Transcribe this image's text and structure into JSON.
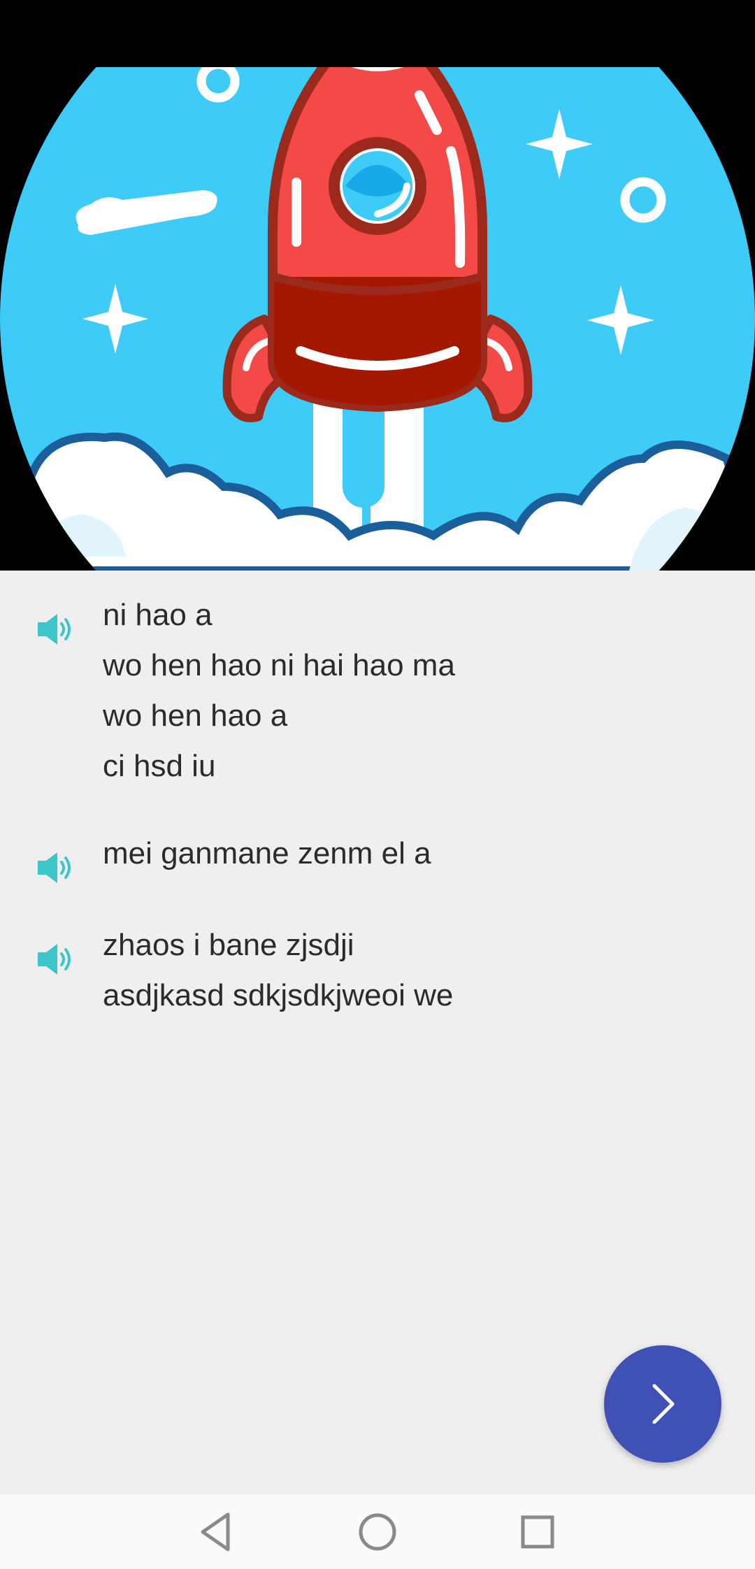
{
  "hero": {
    "image_name": "rocket-illustration",
    "colors": {
      "sky": "#3ecbf7",
      "rocket": "#f44a47",
      "rocket_dark": "#a51800",
      "outline": "#9b2a1c",
      "cloud": "#ffffff",
      "cloud_outline": "#1b5e9c"
    }
  },
  "phrases": [
    {
      "icon": "speaker-icon",
      "lines": [
        "ni hao a",
        "wo hen hao ni hai hao ma",
        "wo hen hao a",
        "ci hsd iu"
      ]
    },
    {
      "icon": "speaker-icon",
      "lines": [
        "mei ganmane zenm el a"
      ]
    },
    {
      "icon": "speaker-icon",
      "lines": [
        "zhaos i bane zjsdji",
        "asdjkasd sdkjsdkjweoi we"
      ]
    }
  ],
  "fab": {
    "icon": "chevron-right-icon",
    "color": "#3f51b5"
  },
  "nav": {
    "back_icon": "back-triangle-icon",
    "home_icon": "home-circle-icon",
    "recents_icon": "recents-square-icon"
  },
  "colors": {
    "speaker": "#3cc6c9",
    "text": "#2b2b2b",
    "background": "#efefef"
  }
}
